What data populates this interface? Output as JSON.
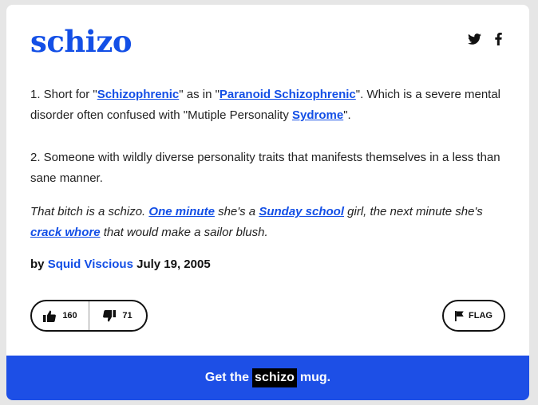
{
  "entry": {
    "word": "schizo",
    "share": {
      "twitter_icon": "twitter-icon",
      "facebook_icon": "facebook-icon"
    },
    "definition": {
      "p1_t1": "1. Short for \"",
      "p1_link1": "Schizophrenic",
      "p1_t2": "\" as in \"",
      "p1_link2": "Paranoid Schizophrenic",
      "p1_t3": "\". Which is a severe mental disorder often confused with \"Mutiple Personality ",
      "p1_link3": "Sydrome",
      "p1_t4": "\".",
      "p2": "2. Someone with wildly diverse personality traits that manifests themselves in a less than sane manner."
    },
    "example": {
      "t1": "That bitch is a schizo. ",
      "link1": "One minute",
      "t2": " she's a ",
      "link2": "Sunday school",
      "t3": " girl, the next minute she's ",
      "link3": "crack whore",
      "t4": " that would make a sailor blush."
    },
    "byline": {
      "prefix": "by ",
      "author": "Squid Viscious",
      "date": " July 19, 2005"
    },
    "votes": {
      "up": "160",
      "down": "71"
    },
    "flag_label": "FLAG",
    "mug": {
      "prefix": "Get the",
      "word": "schizo",
      "suffix": "mug."
    }
  },
  "colors": {
    "accent": "#134fe6",
    "mug_bar": "#1d4fe6",
    "background": "#e6e6e6"
  }
}
